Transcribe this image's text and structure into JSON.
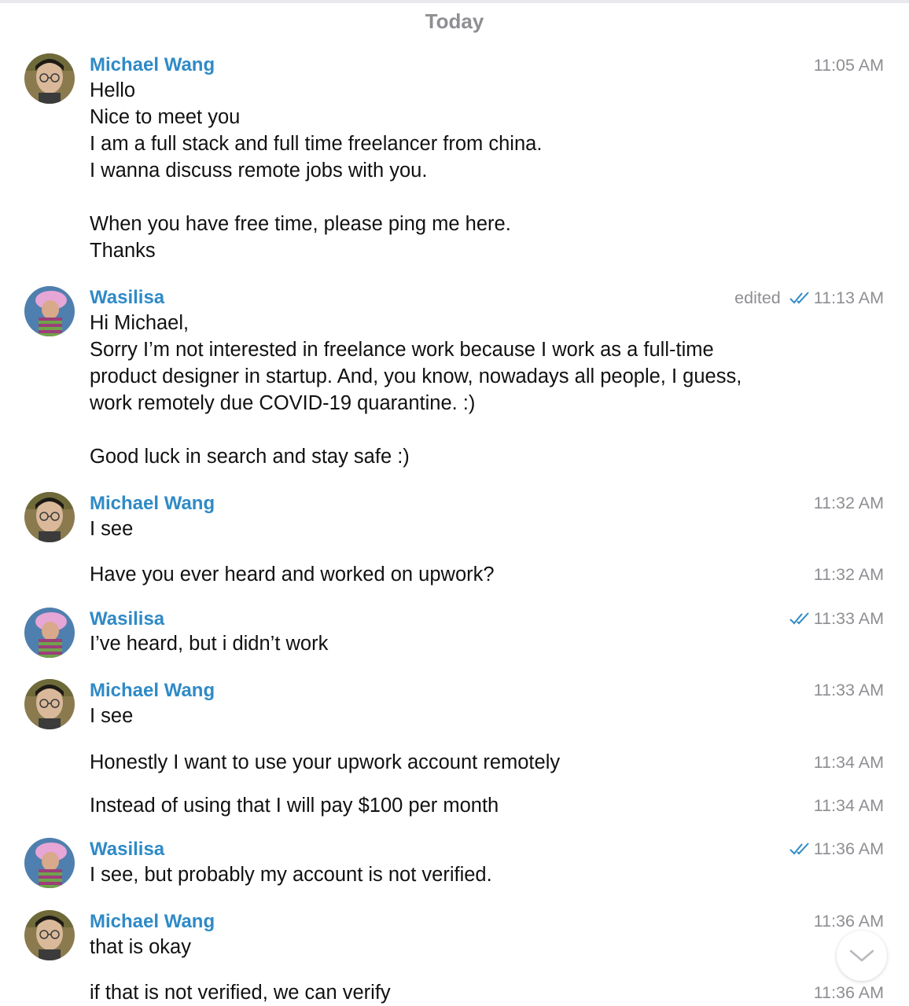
{
  "date_separator": "Today",
  "colors": {
    "name": "#2f8ac6",
    "meta": "#8e8e93",
    "check": "#2f8ac6"
  },
  "messages": [
    {
      "sender": "Michael Wang",
      "time": "11:05 AM",
      "text": "Hello\nNice to meet you\nI am a full stack and full time freelancer from china.\nI wanna discuss remote jobs with  you.\n\nWhen you have free time, please ping me here.\nThanks"
    },
    {
      "sender": "Wasilisa",
      "edited": "edited",
      "read_icon": "double-check-icon",
      "time": "11:13 AM",
      "text": "Hi Michael,\nSorry I’m not interested in freelance work because I work as a full-time product designer in startup. And, you know, nowadays all people, I guess, work remotely due COVID-19 quarantine. :)\n\nGood luck in search and stay safe :)"
    },
    {
      "sender": "Michael Wang",
      "time": "11:32 AM",
      "text": "I see"
    },
    {
      "time": "11:32 AM",
      "text": "Have you ever heard and worked on upwork?"
    },
    {
      "sender": "Wasilisa",
      "read_icon": "double-check-icon",
      "time": "11:33 AM",
      "text": "I’ve heard, but i didn’t work"
    },
    {
      "sender": "Michael Wang",
      "time": "11:33 AM",
      "text": "I see"
    },
    {
      "time": "11:34 AM",
      "text": "Honestly I want to use your upwork account remotely"
    },
    {
      "time": "11:34 AM",
      "text": "Instead of using that I will pay $100 per month"
    },
    {
      "sender": "Wasilisa",
      "read_icon": "double-check-icon",
      "time": "11:36 AM",
      "text": "I see, but probably my account is not verified."
    },
    {
      "sender": "Michael Wang",
      "time": "11:36 AM",
      "text": "that is okay"
    },
    {
      "time": "11:36 AM",
      "text": "if  that is not verified, we can verify"
    }
  ],
  "scroll_button_icon": "chevron-down-icon"
}
